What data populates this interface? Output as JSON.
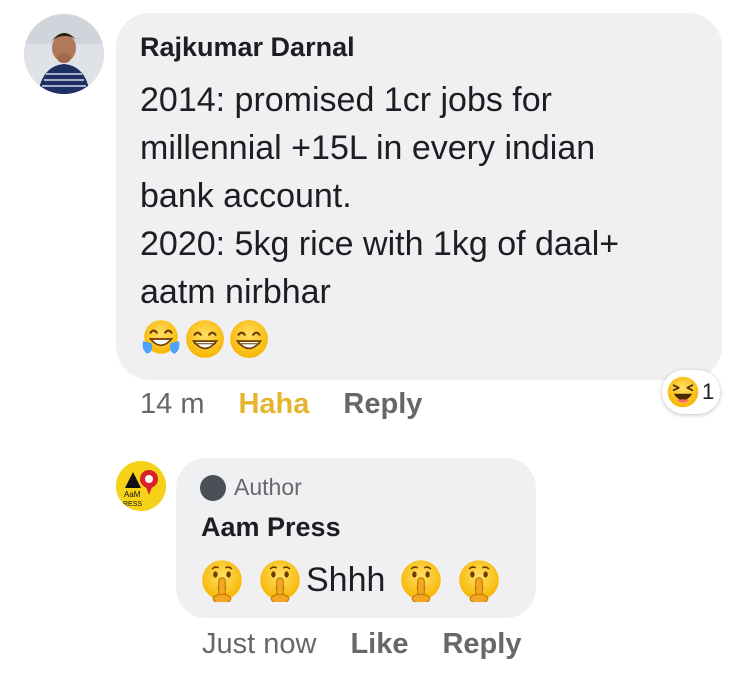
{
  "comment1": {
    "author": "Rajkumar Darnal",
    "lines": [
      "2014: promised 1cr jobs for",
      "millennial +15L in every indian",
      "bank account.",
      "2020: 5kg rice with 1kg of daal+",
      "aatm nirbhar"
    ],
    "emojis": [
      "tears-of-joy-emoji",
      "grinning-emoji",
      "grinning-emoji"
    ],
    "time": "14 m",
    "reaction_label": "Haha",
    "reply_label": "Reply",
    "reaction_badge": {
      "icon": "haha-reaction-icon",
      "count": "1"
    }
  },
  "comment2": {
    "badge": "Author",
    "author": "Aam Press",
    "avatar_text": {
      "line1": "AaM",
      "line2": "RESS"
    },
    "text": "Shhh",
    "emojis_before": [
      "shushing-face-emoji",
      "shushing-face-emoji"
    ],
    "emojis_after": [
      "shushing-face-emoji",
      "shushing-face-emoji"
    ],
    "time": "Just now",
    "like_label": "Like",
    "reply_label": "Reply"
  },
  "colors": {
    "bubble": "#f0f0f3",
    "haha": "#e7b430",
    "meta": "#65676b",
    "text": "#1c1e21",
    "press_yellow": "#f5d217",
    "press_red": "#d8222a"
  }
}
